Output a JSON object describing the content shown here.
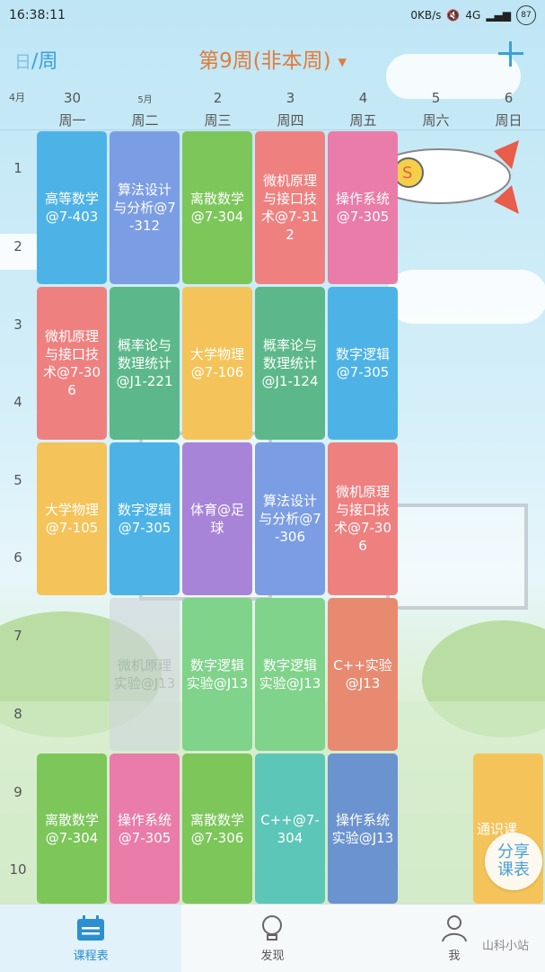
{
  "status": {
    "time": "16:38:11",
    "net_speed": "0KB/s",
    "signal": "4G",
    "battery": "87"
  },
  "header": {
    "toggle_day": "日",
    "toggle_sep": "/",
    "toggle_week": "周",
    "week_title": "第9周(非本周)",
    "dropdown_caret": "▼",
    "add_icon": "plus-icon"
  },
  "days": {
    "month_label": "4月",
    "columns": [
      {
        "date": "30",
        "sub": "",
        "weekday": "周一"
      },
      {
        "date": "",
        "sub": "5月",
        "weekday": "周二"
      },
      {
        "date": "2",
        "sub": "",
        "weekday": "周三"
      },
      {
        "date": "3",
        "sub": "",
        "weekday": "周四"
      },
      {
        "date": "4",
        "sub": "",
        "weekday": "周五"
      },
      {
        "date": "5",
        "sub": "",
        "weekday": "周六"
      },
      {
        "date": "6",
        "sub": "",
        "weekday": "周日"
      }
    ]
  },
  "periods": [
    "1",
    "2",
    "3",
    "4",
    "5",
    "6",
    "7",
    "8",
    "9",
    "10"
  ],
  "courses": [
    {
      "text": "高等数学@7-403",
      "color": "#4db3e6"
    },
    {
      "text": "算法设计与分析@7-312",
      "color": "#7b9de4"
    },
    {
      "text": "离散数学@7-304",
      "color": "#7cc65a"
    },
    {
      "text": "微机原理与接口技术@7-312",
      "color": "#ef8080"
    },
    {
      "text": "操作系统@7-305",
      "color": "#e97ca8"
    },
    {
      "text": "微机原理与接口技术@7-306",
      "color": "#ef8080"
    },
    {
      "text": "概率论与数理统计@J1-221",
      "color": "#5cb88a"
    },
    {
      "text": "大学物理@7-106",
      "color": "#f4c45a"
    },
    {
      "text": "概率论与数理统计@J1-124",
      "color": "#5cb88a"
    },
    {
      "text": "数字逻辑@7-305",
      "color": "#4db3e6"
    },
    {
      "text": "大学物理@7-105",
      "color": "#f4c45a"
    },
    {
      "text": "数字逻辑@7-305",
      "color": "#4db3e6"
    },
    {
      "text": "体育@足球",
      "color": "#a884d8"
    },
    {
      "text": "算法设计与分析@7-306",
      "color": "#7b9de4"
    },
    {
      "text": "微机原理与接口技术@7-306",
      "color": "#ef8080"
    },
    {
      "text": "微机原理实验@J13",
      "color": "#cfd6dc"
    },
    {
      "text": "数字逻辑实验@J13",
      "color": "#7fd38a"
    },
    {
      "text": "数字逻辑实验@J13",
      "color": "#7fd38a"
    },
    {
      "text": "C++实验@J13",
      "color": "#e88a70"
    },
    {
      "text": "离散数学@7-304",
      "color": "#7cc65a"
    },
    {
      "text": "操作系统@7-305",
      "color": "#e97ca8"
    },
    {
      "text": "离散数学@7-306",
      "color": "#7cc65a"
    },
    {
      "text": "C++@7-304",
      "color": "#5cc6b8"
    },
    {
      "text": "操作系统实验@J13",
      "color": "#6b93cf"
    },
    {
      "text": "通识课",
      "color": "#f4c45a"
    }
  ],
  "share_button": {
    "line1": "分享",
    "line2": "课表"
  },
  "nav": [
    {
      "label": "课程表",
      "icon": "calendar-icon",
      "active": true
    },
    {
      "label": "发现",
      "icon": "lightbulb-icon",
      "active": false
    },
    {
      "label": "我",
      "icon": "person-icon",
      "active": false
    }
  ],
  "watermark": "山科小站"
}
